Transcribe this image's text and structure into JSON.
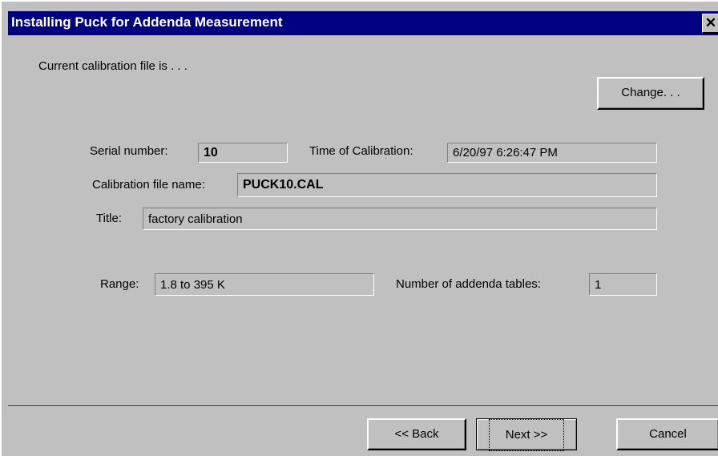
{
  "window": {
    "title": "Installing Puck for Addenda Measurement",
    "close_glyph": "✕"
  },
  "header": {
    "current_file_label": "Current calibration file is . . .",
    "change_button": "Change. . ."
  },
  "fields": {
    "serial_number_label": "Serial number:",
    "serial_number_value": "10",
    "time_label": "Time of Calibration:",
    "time_value": "6/20/97 6:26:47 PM",
    "file_name_label": "Calibration file name:",
    "file_name_value": "PUCK10.CAL",
    "title_label": "Title:",
    "title_value": "factory calibration",
    "range_label": "Range:",
    "range_value": "1.8 to 395 K",
    "addenda_tables_label": "Number of addenda tables:",
    "addenda_tables_value": "1"
  },
  "footer": {
    "back_button": "<< Back",
    "next_button": "Next >>",
    "cancel_button": "Cancel"
  }
}
